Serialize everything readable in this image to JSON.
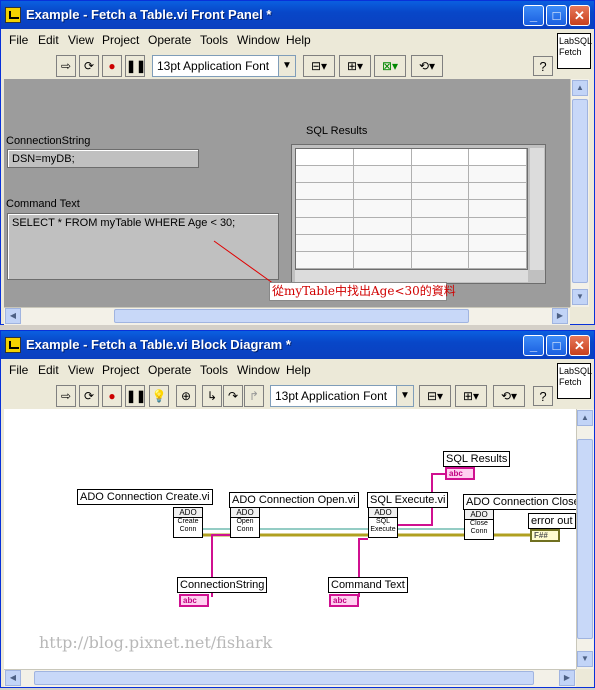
{
  "front_panel": {
    "title": "Example - Fetch a Table.vi Front Panel *",
    "menu": [
      "File",
      "Edit",
      "View",
      "Project",
      "Operate",
      "Tools",
      "Window",
      "Help"
    ],
    "font_select": "13pt Application Font",
    "context_help": "LabSQL Fetch",
    "connection_label": "ConnectionString",
    "connection_value": "DSN=myDB;",
    "command_label": "Command Text",
    "command_value": "SELECT * FROM myTable WHERE Age < 30;",
    "results_label": "SQL Results",
    "annotation": "從myTable中找出Age<30的資料"
  },
  "block_diagram": {
    "title": "Example - Fetch a Table.vi Block Diagram *",
    "menu": [
      "File",
      "Edit",
      "View",
      "Project",
      "Operate",
      "Tools",
      "Window",
      "Help"
    ],
    "font_select": "13pt Application Font",
    "context_help": "LabSQL Fetch",
    "labels": {
      "create": "ADO Connection Create.vi",
      "open": "ADO Connection Open.vi",
      "execute": "SQL Execute.vi",
      "close": "ADO Connection Close.",
      "sql_results": "SQL Results",
      "error_out": "error out",
      "connection_string": "ConnectionString",
      "command_text": "Command Text"
    },
    "vi_icons": {
      "create": [
        "ADO",
        "Create",
        "Conn"
      ],
      "open": [
        "ADO",
        "Open",
        "Conn"
      ],
      "execute": [
        "ADO",
        "SQL",
        "Execute"
      ],
      "close": [
        "ADO",
        "Close",
        "Conn"
      ]
    },
    "terminal_abc": "abc",
    "terminal_err": "F##",
    "watermark": "http://blog.pixnet.net/fishark"
  },
  "colors": {
    "titlebar": "#0a4fd0",
    "canvas_gray": "#9c9c9c",
    "annotation_text": "#d00000",
    "string_wire": "#d01090",
    "refnum_wire": "#2a9a8a",
    "error_wire": "#b0a020"
  }
}
